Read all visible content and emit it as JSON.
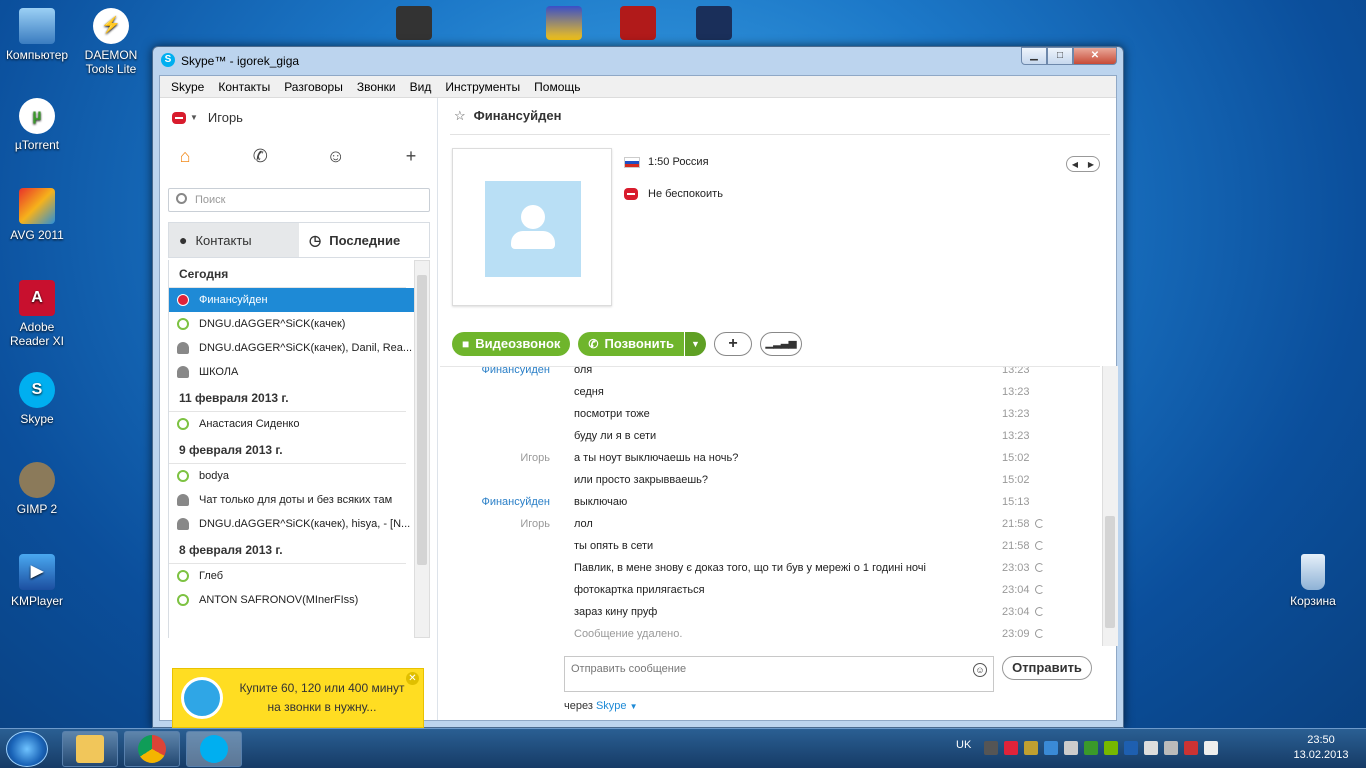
{
  "desktop": {
    "icons": [
      {
        "label": "Компьютер",
        "icon": "computer-icon"
      },
      {
        "label": "DAEMON Tools Lite",
        "icon": "daemon-tools-icon"
      },
      {
        "label": "µTorrent",
        "icon": "utorrent-icon"
      },
      {
        "label": "AVG 2011",
        "icon": "avg-icon"
      },
      {
        "label": "Adobe Reader XI",
        "icon": "adobe-reader-icon"
      },
      {
        "label": "Skype",
        "icon": "skype-icon"
      },
      {
        "label": "GIMP 2",
        "icon": "gimp-icon"
      },
      {
        "label": "KMPlayer",
        "icon": "kmplayer-icon"
      },
      {
        "label": "Корзина",
        "icon": "recycle-bin-icon"
      }
    ]
  },
  "window": {
    "title": "Skype™ - igorek_giga",
    "menu": [
      "Skype",
      "Контакты",
      "Разговоры",
      "Звонки",
      "Вид",
      "Инструменты",
      "Помощь"
    ]
  },
  "sidebar": {
    "user_name": "Игорь",
    "search_placeholder": "Поиск",
    "tab_contacts": "Контакты",
    "tab_recent": "Последние",
    "groups": [
      {
        "header": "Сегодня",
        "items": [
          {
            "name": "Финансуйден",
            "status": "dnd",
            "selected": true
          },
          {
            "name": "DNGU.dAGGER^SiCK(качек)",
            "status": "online"
          },
          {
            "name": "DNGU.dAGGER^SiCK(качек), Danil, Rea...",
            "status": "group"
          },
          {
            "name": "ШКОЛА",
            "status": "group"
          }
        ]
      },
      {
        "header": "11 февраля 2013 г.",
        "items": [
          {
            "name": "Анастасия Сиденко",
            "status": "online"
          }
        ]
      },
      {
        "header": "9 февраля 2013 г.",
        "items": [
          {
            "name": "bodya",
            "status": "online"
          },
          {
            "name": "Чат только для доты и без всяких там",
            "status": "group"
          },
          {
            "name": "DNGU.dAGGER^SiCK(качек), hisya, - [N...",
            "status": "group"
          }
        ]
      },
      {
        "header": "8 февраля 2013 г.",
        "items": [
          {
            "name": "Глеб",
            "status": "online"
          },
          {
            "name": "ANTON SAFRONOV(MInerFIss)",
            "status": "online"
          }
        ]
      }
    ],
    "promo_text": "Купите 60, 120 или 400 минут на звонки в нужну..."
  },
  "chat": {
    "contact_name": "Финансуйден",
    "local_time": "1:50 Россия",
    "status_text": "Не беспокоить",
    "video_call_label": "Видеозвонок",
    "call_label": "Позвонить",
    "messages": [
      {
        "who": "Финансуйден",
        "text": "оля",
        "time": "13:23",
        "pending": false,
        "deleted": false
      },
      {
        "who": "",
        "text": "седня",
        "time": "13:23",
        "pending": false,
        "deleted": false
      },
      {
        "who": "",
        "text": "посмотри тоже",
        "time": "13:23",
        "pending": false,
        "deleted": false
      },
      {
        "who": "",
        "text": "буду ли я в сети",
        "time": "13:23",
        "pending": false,
        "deleted": false
      },
      {
        "who": "Игорь",
        "text": "а ты ноут выключаешь на ночь?",
        "time": "15:02",
        "pending": false,
        "deleted": false
      },
      {
        "who": "",
        "text": "или просто закрывваешь?",
        "time": "15:02",
        "pending": false,
        "deleted": false
      },
      {
        "who": "Финансуйден",
        "text": "выключаю",
        "time": "15:13",
        "pending": false,
        "deleted": false
      },
      {
        "who": "Игорь",
        "text": "лол",
        "time": "21:58",
        "pending": true,
        "deleted": false
      },
      {
        "who": "",
        "text": "ты опять в сети",
        "time": "21:58",
        "pending": true,
        "deleted": false
      },
      {
        "who": "",
        "text": "Павлик, в мене знову є доказ того, що ти був у мережі о 1 годині ночі",
        "time": "23:03",
        "pending": true,
        "deleted": false
      },
      {
        "who": "",
        "text": "фотокартка прилягається",
        "time": "23:04",
        "pending": true,
        "deleted": false
      },
      {
        "who": "",
        "text": "зараз кину пруф",
        "time": "23:04",
        "pending": true,
        "deleted": false
      },
      {
        "who": "",
        "text": "Сообщение удалено.",
        "time": "23:09",
        "pending": true,
        "deleted": true
      }
    ],
    "compose_placeholder": "Отправить сообщение",
    "send_label": "Отправить",
    "via_prefix": "через",
    "via_service": "Skype"
  },
  "taskbar": {
    "lang": "UK",
    "time": "23:50",
    "date": "13.02.2013"
  }
}
